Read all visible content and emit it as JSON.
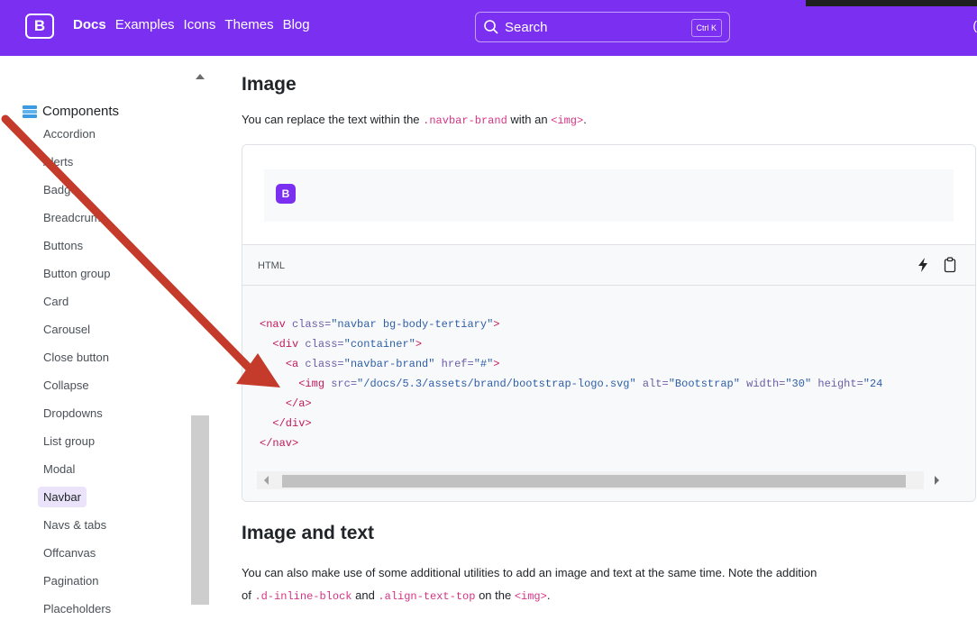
{
  "header": {
    "brand_letter": "B",
    "nav": [
      "Docs",
      "Examples",
      "Icons",
      "Themes",
      "Blog"
    ],
    "active_nav": "Docs",
    "search_placeholder": "Search",
    "search_shortcut": "Ctrl K",
    "edge_char": "("
  },
  "sidebar": {
    "section_title": "Components",
    "items": [
      "Accordion",
      "Alerts",
      "Badge",
      "Breadcrumb",
      "Buttons",
      "Button group",
      "Card",
      "Carousel",
      "Close button",
      "Collapse",
      "Dropdowns",
      "List group",
      "Modal",
      "Navbar",
      "Navs & tabs",
      "Offcanvas",
      "Pagination",
      "Placeholders"
    ],
    "active_item": "Navbar"
  },
  "main": {
    "title": "Image",
    "intro_before": "You can replace the text within the ",
    "intro_code1": ".navbar-brand",
    "intro_mid": " with an ",
    "intro_code2": "<img>",
    "intro_after": ".",
    "preview_logo": "B",
    "code_lang": "HTML",
    "code_lines": [
      [
        [
          "tag",
          "<nav "
        ],
        [
          "attr",
          "class="
        ],
        [
          "val",
          "\"navbar bg-body-tertiary\""
        ],
        [
          "tag",
          ">"
        ]
      ],
      [
        [
          "plain",
          "  "
        ],
        [
          "tag",
          "<div "
        ],
        [
          "attr",
          "class="
        ],
        [
          "val",
          "\"container\""
        ],
        [
          "tag",
          ">"
        ]
      ],
      [
        [
          "plain",
          "    "
        ],
        [
          "tag",
          "<a "
        ],
        [
          "attr",
          "class="
        ],
        [
          "val",
          "\"navbar-brand\""
        ],
        [
          "attr",
          " href="
        ],
        [
          "val",
          "\"#\""
        ],
        [
          "tag",
          ">"
        ]
      ],
      [
        [
          "plain",
          "      "
        ],
        [
          "tag",
          "<img "
        ],
        [
          "attr",
          "src="
        ],
        [
          "val",
          "\"/docs/5.3/assets/brand/bootstrap-logo.svg\""
        ],
        [
          "attr",
          " alt="
        ],
        [
          "val",
          "\"Bootstrap\""
        ],
        [
          "attr",
          " width="
        ],
        [
          "val",
          "\"30\""
        ],
        [
          "attr",
          " height="
        ],
        [
          "val",
          "\"24"
        ]
      ],
      [
        [
          "plain",
          "    "
        ],
        [
          "tag",
          "</a>"
        ]
      ],
      [
        [
          "plain",
          "  "
        ],
        [
          "tag",
          "</div>"
        ]
      ],
      [
        [
          "tag",
          "</nav>"
        ]
      ]
    ],
    "section2_title": "Image and text",
    "section2_line1": "You can also make use of some additional utilities to add an image and text at the same time. Note the addition",
    "section2_before": "of ",
    "section2_code1": ".d-inline-block",
    "section2_and": " and ",
    "section2_code2": ".align-text-top",
    "section2_on": " on the ",
    "section2_code3": "<img>",
    "section2_end": "."
  },
  "colors": {
    "brand_purple": "#7b2ff0",
    "annotation_arrow": "#c43a2b",
    "code_tag": "#c2185b",
    "active_item_bg": "#ebe3f9"
  },
  "icons": [
    "search-icon",
    "components-icon",
    "bolt-icon",
    "clipboard-icon",
    "scroll-up-icon",
    "scroll-left-icon",
    "scroll-right-icon"
  ]
}
